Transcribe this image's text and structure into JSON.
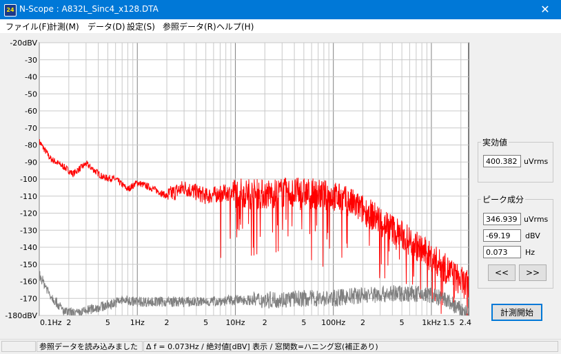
{
  "window": {
    "title": "N-Scope : A832L_Sinc4_x128.DTA",
    "close_glyph": "✕",
    "icon_text": "24"
  },
  "menu": [
    "ファイル(F)",
    "計測(M)",
    "データ(D)",
    "設定(S)",
    "参照データ(R)",
    "ヘルプ(H)"
  ],
  "panel": {
    "rms": {
      "label": "実効値",
      "value": "400.382",
      "unit": "uVrms"
    },
    "peak": {
      "label": "ピーク成分",
      "value_uv": "346.939",
      "unit_uv": "uVrms",
      "value_db": "-69.19",
      "unit_db": "dBV",
      "value_hz": "0.073",
      "unit_hz": "Hz"
    },
    "prev_button": "<<",
    "next_button": ">>",
    "start_button": "計測開始"
  },
  "status": {
    "cell1": "",
    "cell2": "参照データを読み込みました",
    "cell3": "Δ f = 0.073Hz / 絶対値[dBV] 表示 / 窓関数=ハニング窓(補正あり)"
  },
  "chart_data": {
    "type": "line",
    "x_scale": "log",
    "xlim": [
      0.1,
      2400
    ],
    "ylim": [
      -180,
      -20
    ],
    "grid": true,
    "y_ticks": [
      "-20dBV",
      "-30",
      "-40",
      "-50",
      "-60",
      "-70",
      "-80",
      "-90",
      "-100",
      "-110",
      "-120",
      "-130",
      "-140",
      "-150",
      "-160",
      "-170",
      "-180dBV"
    ],
    "x_ticks": [
      {
        "v": 0.1,
        "label": "0.1Hz"
      },
      {
        "v": 0.2,
        "label": "2"
      },
      {
        "v": 0.5,
        "label": "5"
      },
      {
        "v": 1,
        "label": "1Hz"
      },
      {
        "v": 2,
        "label": "2"
      },
      {
        "v": 5,
        "label": "5"
      },
      {
        "v": 10,
        "label": "10Hz"
      },
      {
        "v": 20,
        "label": "2"
      },
      {
        "v": 50,
        "label": "5"
      },
      {
        "v": 100,
        "label": "100Hz"
      },
      {
        "v": 200,
        "label": "2"
      },
      {
        "v": 500,
        "label": "5"
      },
      {
        "v": 1000,
        "label": "1kHz"
      },
      {
        "v": 1500,
        "label": "1.5"
      },
      {
        "v": 2400,
        "label": "2.4"
      }
    ],
    "series": [
      {
        "color": "#ff0000",
        "x": [
          0.1,
          0.13,
          0.18,
          0.22,
          0.3,
          0.45,
          0.6,
          0.8,
          1,
          1.5,
          2,
          3,
          5,
          8,
          10,
          20,
          30,
          50,
          70,
          100,
          150,
          200,
          300,
          500,
          700,
          1000,
          1500,
          2000,
          2400
        ],
        "y": [
          -78,
          -88,
          -93,
          -97,
          -91,
          -99,
          -100,
          -106,
          -102,
          -106,
          -110,
          -105,
          -110,
          -108,
          -108,
          -109,
          -108,
          -108,
          -109,
          -110,
          -114,
          -118,
          -124,
          -133,
          -139,
          -146,
          -154,
          -160,
          -163
        ]
      },
      {
        "color": "#808080",
        "x": [
          0.1,
          0.13,
          0.18,
          0.25,
          0.35,
          0.5,
          0.7,
          1,
          2,
          5,
          10,
          20,
          50,
          100,
          200,
          500,
          1000,
          1500,
          2000,
          2400
        ],
        "y": [
          -156,
          -168,
          -178,
          -179,
          -176,
          -174,
          -171,
          -172,
          -172,
          -172,
          -171,
          -171,
          -170,
          -170,
          -168,
          -167,
          -168,
          -172,
          -177,
          -180
        ]
      }
    ]
  }
}
